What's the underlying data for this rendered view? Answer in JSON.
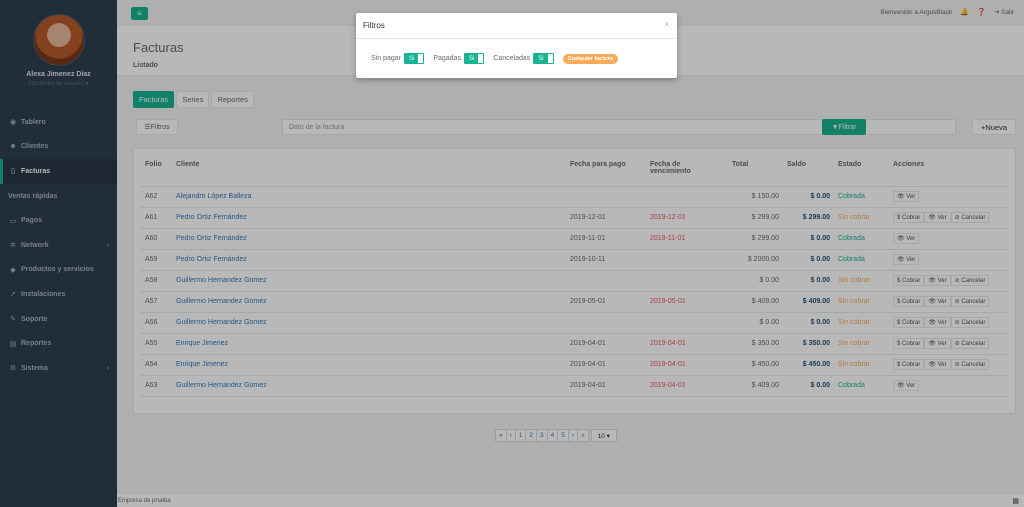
{
  "sidebar": {
    "user_name": "Alexa Jimenez Díaz",
    "user_options": "Opciones de usuario ▾",
    "items": [
      {
        "label": "Tablero",
        "icon": "dashboard-icon"
      },
      {
        "label": "Clientes",
        "icon": "users-icon"
      },
      {
        "label": "Facturas",
        "icon": "file-icon"
      },
      {
        "label": "Ventas rápidas",
        "icon": "dollar-icon"
      },
      {
        "label": "Pagos",
        "icon": "money-icon"
      },
      {
        "label": "Network",
        "icon": "network-icon"
      },
      {
        "label": "Productos y servicios",
        "icon": "tag-icon"
      },
      {
        "label": "Instalaciones",
        "icon": "rocket-icon"
      },
      {
        "label": "Soporte",
        "icon": "wrench-icon"
      },
      {
        "label": "Reportes",
        "icon": "reports-icon"
      },
      {
        "label": "Sistema",
        "icon": "cogs-icon"
      }
    ]
  },
  "topbar": {
    "welcome": "Bienvenido a ArgusBlack",
    "logout": "Salir"
  },
  "heading": {
    "title": "Facturas",
    "subtitle": "Listado"
  },
  "tabs": [
    "Facturas",
    "Series",
    "Reportes"
  ],
  "filters": {
    "filtros_label": "Filtros",
    "search_placeholder": "Dato de la factura",
    "filtrar_label": "Filtrar",
    "nueva_label": "Nueva"
  },
  "table": {
    "headers": {
      "folio": "Folio",
      "cliente": "Cliente",
      "fecha_pago_1": "Fecha para pago",
      "fecha_venc_1": "Fecha de",
      "fecha_venc_2": "vencimiento",
      "total": "Total",
      "saldo": "Saldo",
      "estado": "Estado",
      "acciones": "Acciones"
    },
    "rows": [
      {
        "folio": "A62",
        "cliente": "Alejandro López Balleza",
        "pago": "",
        "venc": "",
        "total": "$ 150.00",
        "saldo": "$ 0.00",
        "estado": "Cobrada",
        "paid": true
      },
      {
        "folio": "A61",
        "cliente": "Pedro Ortiz Fernández",
        "pago": "2019-12-01",
        "venc": "2019-12-01",
        "total": "$ 299.00",
        "saldo": "$ 299.00",
        "estado": "Sin cobrar",
        "paid": false
      },
      {
        "folio": "A60",
        "cliente": "Pedro Ortiz Fernández",
        "pago": "2019-11-01",
        "venc": "2019-11-01",
        "total": "$ 299.00",
        "saldo": "$ 0.00",
        "estado": "Cobrada",
        "paid": true
      },
      {
        "folio": "A59",
        "cliente": "Pedro Ortiz Fernández",
        "pago": "2019-10-11",
        "venc": "",
        "total": "$ 2000.00",
        "saldo": "$ 0.00",
        "estado": "Cobrada",
        "paid": true
      },
      {
        "folio": "A58",
        "cliente": "Guillermo Hernandez Gomez",
        "pago": "",
        "venc": "",
        "total": "$ 0.00",
        "saldo": "$ 0.00",
        "estado": "Sin cobrar",
        "paid": false
      },
      {
        "folio": "A57",
        "cliente": "Guillermo Hernandez Gomez",
        "pago": "2019-05-01",
        "venc": "2019-05-01",
        "total": "$ 409.00",
        "saldo": "$ 409.00",
        "estado": "Sin cobrar",
        "paid": false
      },
      {
        "folio": "A56",
        "cliente": "Guillermo Hernandez Gomez",
        "pago": "",
        "venc": "",
        "total": "$ 0.00",
        "saldo": "$ 0.00",
        "estado": "Sin cobrar",
        "paid": false
      },
      {
        "folio": "A55",
        "cliente": "Enrique Jimenez",
        "pago": "2019-04-01",
        "venc": "2019-04-01",
        "total": "$ 350.00",
        "saldo": "$ 350.00",
        "estado": "Sin cobrar",
        "paid": false
      },
      {
        "folio": "A54",
        "cliente": "Enrique Jimenez",
        "pago": "2019-04-01",
        "venc": "2019-04-01",
        "total": "$ 450.00",
        "saldo": "$ 450.00",
        "estado": "Sin cobrar",
        "paid": false
      },
      {
        "folio": "A53",
        "cliente": "Guillermo Hernandez Gomez",
        "pago": "2019-04-01",
        "venc": "2019-04-01",
        "total": "$ 409.00",
        "saldo": "$ 0.00",
        "estado": "Cobrada",
        "paid": true
      }
    ],
    "actions": {
      "cobrar": "$ Cobrar",
      "ver": "👁 Ver",
      "cancelar": "⊘ Cancelar"
    }
  },
  "pagination": {
    "first": "«",
    "prev": "‹",
    "pages": [
      "1",
      "2",
      "3",
      "4",
      "5"
    ],
    "next": "›",
    "last": "»",
    "per_page": "10 ▾"
  },
  "footer": {
    "company": "Empresa de prueba"
  },
  "modal": {
    "title": "Filtros",
    "close": "×",
    "toggles": [
      {
        "label": "Sin pagar",
        "value": "Si"
      },
      {
        "label": "Pagadas",
        "value": "Si"
      },
      {
        "label": "Canceladas",
        "value": "Si"
      }
    ],
    "badge": "Cualquier factura"
  },
  "colors": {
    "accent": "#1ab394",
    "sidebar": "#2f4050",
    "warning": "#f8ac59",
    "danger": "#ed5565"
  }
}
